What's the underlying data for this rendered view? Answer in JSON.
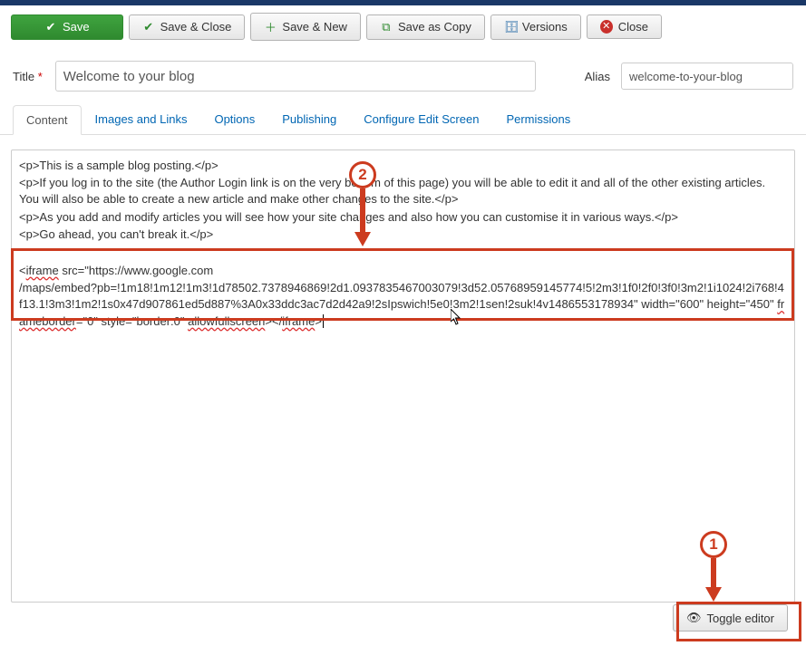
{
  "toolbar": {
    "save": "Save",
    "save_close": "Save & Close",
    "save_new": "Save & New",
    "save_copy": "Save as Copy",
    "versions": "Versions",
    "close": "Close"
  },
  "fields": {
    "title_label": "Title",
    "title_value": "Welcome to your blog",
    "alias_label": "Alias",
    "alias_value": "welcome-to-your-blog"
  },
  "tabs": {
    "content": "Content",
    "images": "Images and Links",
    "options": "Options",
    "publishing": "Publishing",
    "config": "Configure Edit Screen",
    "permissions": "Permissions"
  },
  "editor": {
    "p1": "<p>This is a sample blog posting.</p>",
    "p2": "<p>If you log in to the site (the Author Login link is on the very bottom of this page) you will be able to edit it and all of the other existing articles. You will also be able to create a new article and make other changes to the site.</p>",
    "p3": "<p>As you add and modify articles you will see how your site changes and also how you can customise it in various ways.</p>",
    "p4": "<p>Go ahead, you can't break it.</p>",
    "iframe_a": "<",
    "iframe_b": "iframe",
    "iframe_c": " src=\"https://www.google.com",
    "iframe_line2": "/maps/embed?pb=!1m18!1m12!1m3!1d78502.7378946869!2d1.0937835467003079!3d52.05768959145774!5!2m3!1f0!2f0!3f0!3m2!1i1024!2i768!4f13.1!3m3!1m2!1s0x47d907861ed5d887%3A0x33ddc3ac7d2d42a9!2sIpswich!5e0!3m2!1sen!2suk!4v1486553178934\" width=\"600\" height=\"450\" ",
    "iframe_d": "frameborder",
    "iframe_e": "=\"0\" style=\"border:0\" ",
    "iframe_f": "allowfullscreen",
    "iframe_g": "></",
    "iframe_h": "iframe",
    "iframe_i": ">"
  },
  "footer": {
    "toggle": "Toggle editor"
  },
  "annotations": {
    "num1": "1",
    "num2": "2"
  }
}
